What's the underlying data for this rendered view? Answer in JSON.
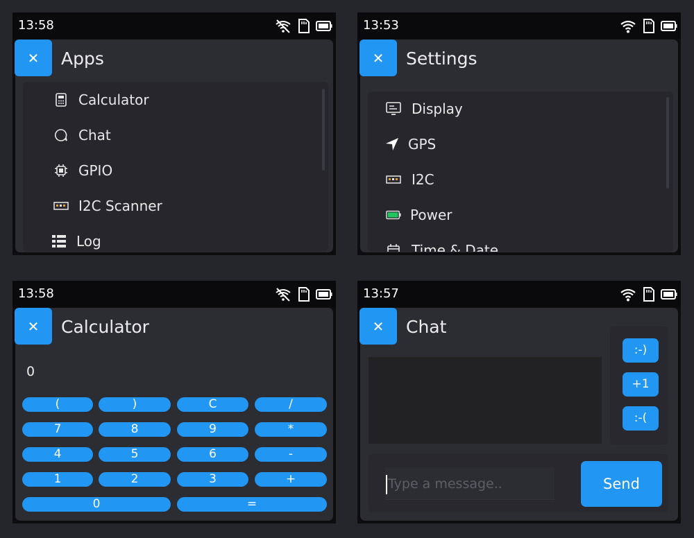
{
  "screens": {
    "apps": {
      "time": "13:58",
      "title": "Apps",
      "close_symbol": "✕",
      "items": [
        {
          "label": "Calculator",
          "icon": "calculator-icon"
        },
        {
          "label": "Chat",
          "icon": "chat-bubble-icon"
        },
        {
          "label": "GPIO",
          "icon": "chip-icon"
        },
        {
          "label": "I2C Scanner",
          "icon": "i2c-bus-icon"
        },
        {
          "label": "Log",
          "icon": "list-icon"
        }
      ]
    },
    "settings": {
      "time": "13:53",
      "title": "Settings",
      "close_symbol": "✕",
      "items": [
        {
          "label": "Display",
          "icon": "display-icon"
        },
        {
          "label": "GPS",
          "icon": "navigation-arrow-icon"
        },
        {
          "label": "I2C",
          "icon": "i2c-bus-icon"
        },
        {
          "label": "Power",
          "icon": "battery-icon"
        },
        {
          "label": "Time & Date",
          "icon": "clock-icon"
        }
      ]
    },
    "calculator": {
      "time": "13:58",
      "title": "Calculator",
      "close_symbol": "✕",
      "display_value": "0",
      "buttons": [
        [
          "(",
          ")",
          "C",
          "/"
        ],
        [
          "7",
          "8",
          "9",
          "*"
        ],
        [
          "4",
          "5",
          "6",
          "-"
        ],
        [
          "1",
          "2",
          "3",
          "+"
        ],
        [
          "0",
          "="
        ]
      ]
    },
    "chat": {
      "time": "13:57",
      "title": "Chat",
      "close_symbol": "✕",
      "quick_replies": [
        ":-)",
        "+1",
        ":-("
      ],
      "input_placeholder": "Type a message..",
      "send_label": "Send"
    }
  },
  "colors": {
    "accent": "#2196f3",
    "background": "#25252c",
    "window": "#2c2c33",
    "statusbar": "#0a0a0c",
    "battery_green": "#22c55e"
  }
}
